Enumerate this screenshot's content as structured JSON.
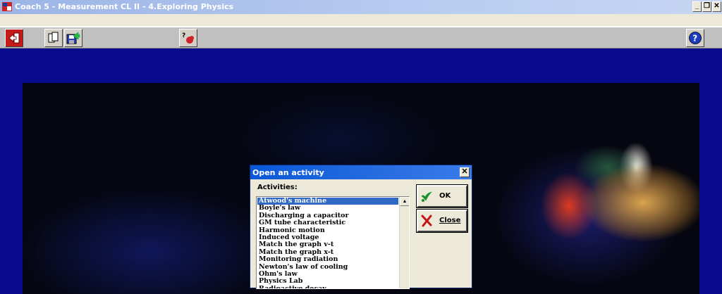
{
  "window": {
    "title": "Coach 5 - Measurement CL II - 4.Exploring Physics",
    "minimize": "_",
    "restore": "❐",
    "close": "✕"
  },
  "toolbar": {
    "exit_icon": "exit-door-icon",
    "documents_icon": "documents-icon",
    "save_icon": "save-icon",
    "help_tool_icon": "question-pointer-icon",
    "help_icon": "help-icon"
  },
  "dialog": {
    "title": "Open an activity",
    "close": "✕",
    "label": "Activities:",
    "activities": [
      "Atwood's machine",
      "Boyle's law",
      "Discharging a capacitor",
      "GM tube characteristic",
      "Harmonic motion",
      "Induced voltage",
      "Match the graph v-t",
      "Match the graph x-t",
      "Monitoring radiation",
      "Newton's law of cooling",
      "Ohm's law",
      "Physics Lab",
      "Radioactive decay"
    ],
    "selected_index": 0,
    "ok_label": "OK",
    "close_label": "Close"
  },
  "colors": {
    "background": "#0a0a8c",
    "selection": "#316ac5",
    "dialog_title": "#0a58d8"
  }
}
